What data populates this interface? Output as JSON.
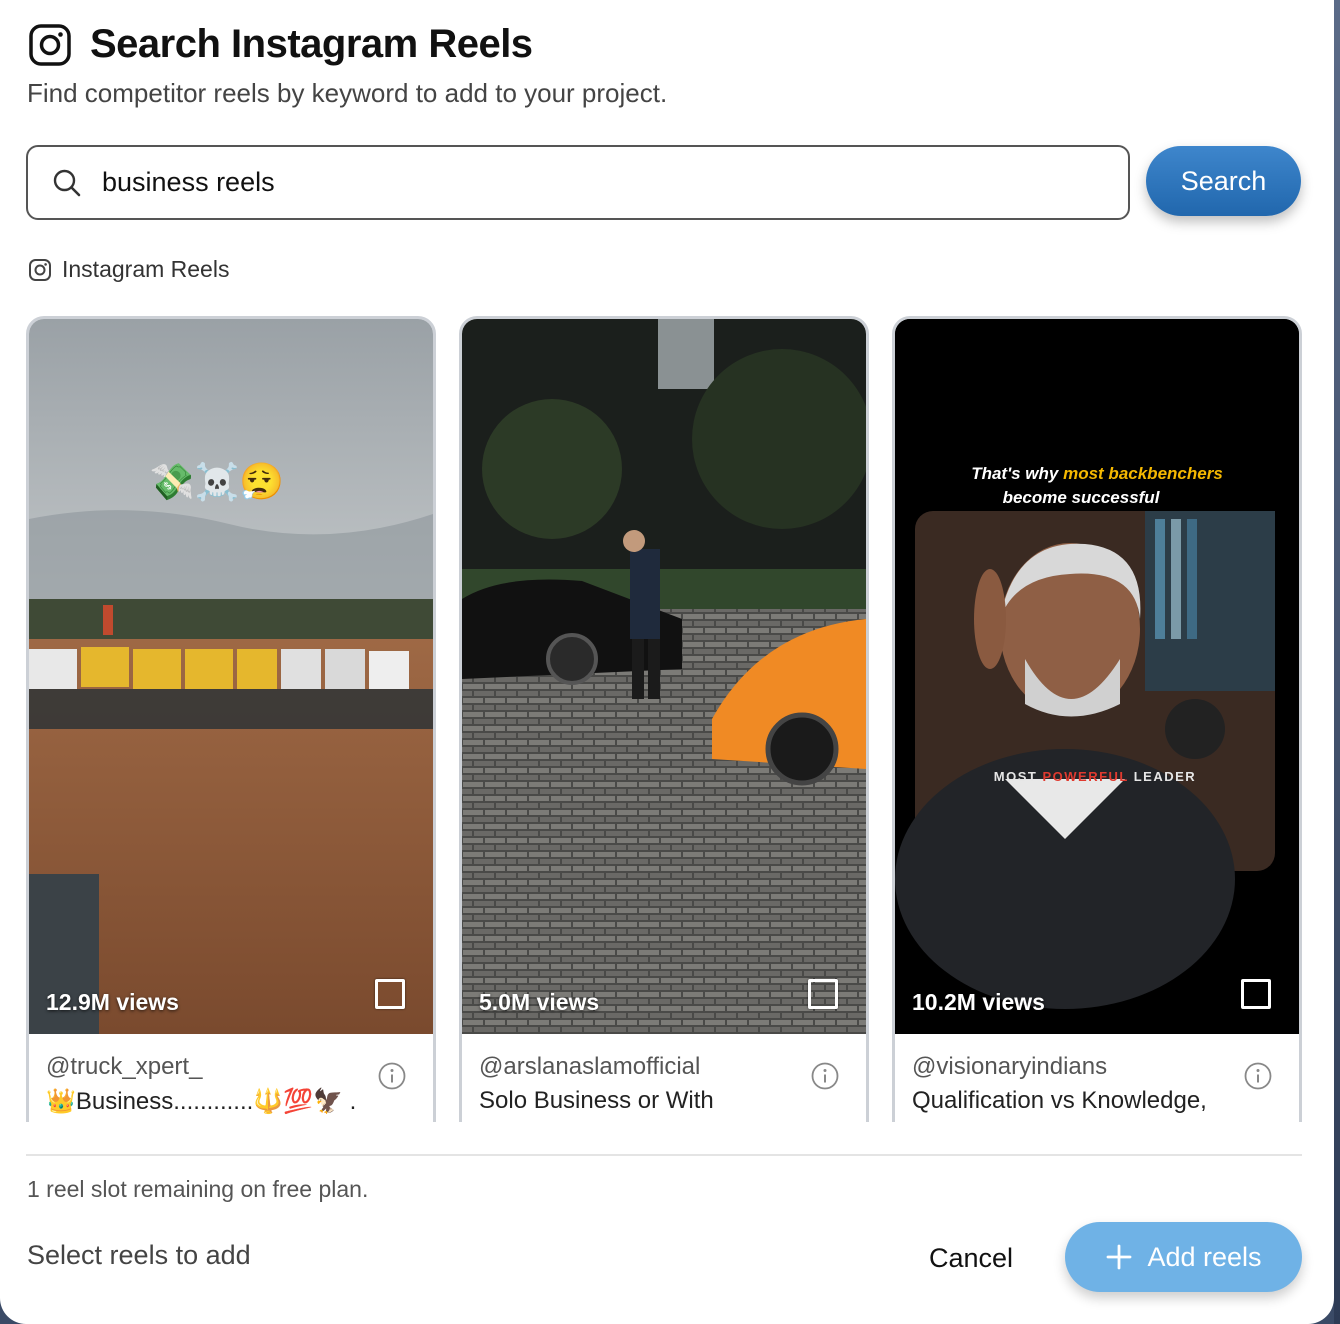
{
  "header": {
    "title": "Search Instagram Reels",
    "subtitle": "Find competitor reels by keyword to add to your project."
  },
  "search": {
    "value": "business reels",
    "button_label": "Search"
  },
  "section": {
    "label": "Instagram Reels"
  },
  "reels": [
    {
      "views": "12.9M views",
      "author": "@truck_xpert_",
      "caption": "👑Business............🔱💯🦅 .",
      "overlay_emoji": "💸☠️😮‍💨",
      "selected": false
    },
    {
      "views": "5.0M views",
      "author": "@arslanaslamofficial",
      "caption": "Solo Business or With",
      "selected": false
    },
    {
      "views": "10.2M views",
      "author": "@visionaryindians",
      "caption": "Qualification vs Knowledge,",
      "overlay_line1_prefix": "That's why ",
      "overlay_line1_highlight": "most backbenchers",
      "overlay_line2": "become successful",
      "lower_third_1": "MOST ",
      "lower_third_2": "POWERFUL",
      "lower_third_3": " LEADER",
      "selected": false
    }
  ],
  "footer": {
    "plan_note": "1 reel slot remaining on free plan.",
    "select_hint": "Select reels to add",
    "cancel_label": "Cancel",
    "add_label": "Add reels"
  },
  "colors": {
    "primary": "#2a72b8",
    "add_button_disabled": "#6fb2e6",
    "highlight": "#f5b800"
  }
}
